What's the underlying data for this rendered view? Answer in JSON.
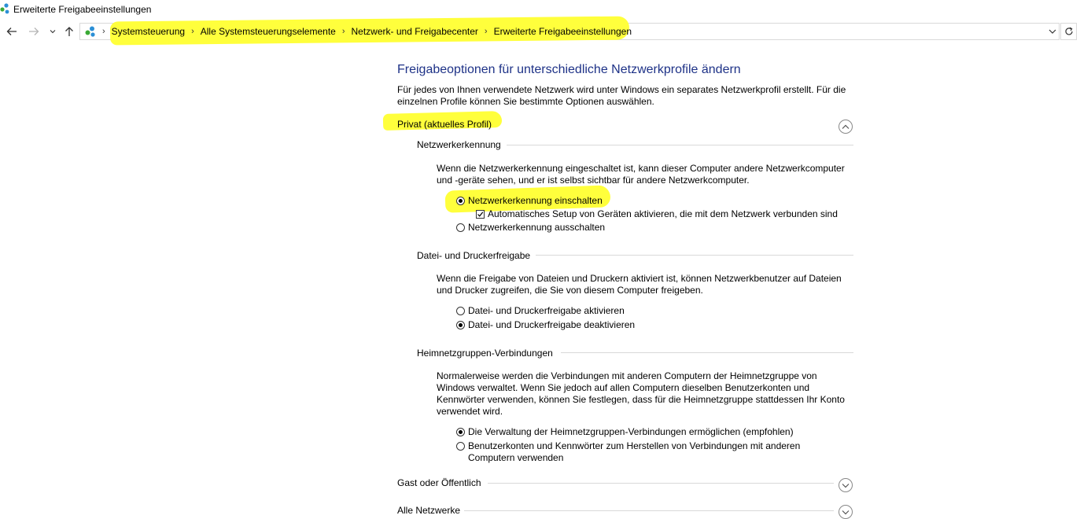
{
  "window": {
    "title": "Erweiterte Freigabeeinstellungen"
  },
  "address": {
    "breadcrumbs": [
      "Systemsteuerung",
      "Alle Systemsteuerungselemente",
      "Netzwerk- und Freigabecenter",
      "Erweiterte Freigabeeinstellungen"
    ]
  },
  "icons": {
    "back": "back-arrow-icon",
    "forward": "forward-arrow-icon",
    "recent": "chevron-down-icon",
    "up": "up-arrow-icon",
    "refresh": "refresh-icon",
    "network": "network-icon"
  },
  "colors": {
    "heading": "#1e3287",
    "highlight": "#ffff3c"
  },
  "main": {
    "heading": "Freigabeoptionen für unterschiedliche Netzwerkprofile ändern",
    "intro_line1": "Für jedes von Ihnen verwendete Netzwerk wird unter Windows ein separates Netzwerkprofil erstellt. Für die",
    "intro_line2": "einzelnen Profile können Sie bestimmte Optionen auswählen."
  },
  "profiles": {
    "private": {
      "title": "Privat (aktuelles Profil)",
      "expanded": true,
      "discovery": {
        "heading": "Netzwerkerkennung",
        "desc_line1": "Wenn die Netzwerkerkennung eingeschaltet ist, kann dieser Computer andere Netzwerkcomputer",
        "desc_line2": "und -geräte sehen, und er ist selbst sichtbar für andere Netzwerkcomputer.",
        "opt_on": "Netzwerkerkennung einschalten",
        "opt_auto": "Automatisches Setup von Geräten aktivieren, die mit dem Netzwerk verbunden sind",
        "opt_off": "Netzwerkerkennung ausschalten"
      },
      "sharing": {
        "heading": "Datei- und Druckerfreigabe",
        "desc_line1": "Wenn die Freigabe von Dateien und Druckern aktiviert ist, können Netzwerkbenutzer auf Dateien",
        "desc_line2": "und Drucker zugreifen, die Sie von diesem Computer freigeben.",
        "opt_on": "Datei- und Druckerfreigabe aktivieren",
        "opt_off": "Datei- und Druckerfreigabe deaktivieren"
      },
      "homegroup": {
        "heading": "Heimnetzgruppen-Verbindungen",
        "desc_line1": "Normalerweise werden die Verbindungen mit anderen Computern der Heimnetzgruppe von",
        "desc_line2": "Windows verwaltet. Wenn Sie jedoch auf allen Computern dieselben Benutzerkonten und",
        "desc_line3": "Kennwörter verwenden, können Sie festlegen, dass für die Heimnetzgruppe stattdessen Ihr Konto",
        "desc_line4": "verwendet wird.",
        "opt_windows": "Die Verwaltung der Heimnetzgruppen-Verbindungen ermöglichen (empfohlen)",
        "opt_accounts_line1": "Benutzerkonten und Kennwörter zum Herstellen von Verbindungen mit anderen",
        "opt_accounts_line2": "Computern verwenden"
      }
    },
    "guest": {
      "title": "Gast oder Öffentlich",
      "expanded": false
    },
    "all": {
      "title": "Alle Netzwerke",
      "expanded": false
    }
  }
}
